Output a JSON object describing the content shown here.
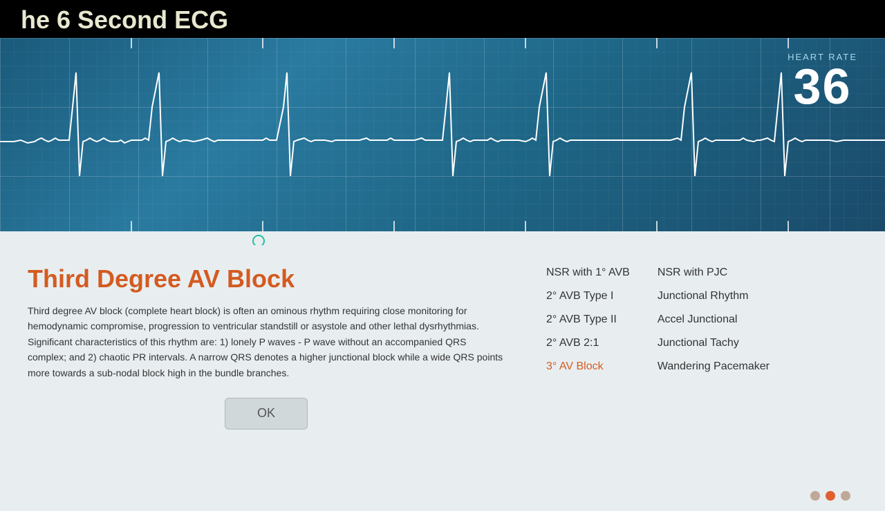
{
  "header": {
    "title": "he 6 Second ECG"
  },
  "ecg": {
    "heart_rate_label": "HEART RATE",
    "heart_rate_value": "36"
  },
  "condition": {
    "title": "Third Degree AV Block",
    "description": "Third degree AV block (complete heart block) is often an ominous rhythm requiring close monitoring for hemodynamic compromise, progression to ventricular standstill or asystole and other lethal dysrhythmias. Significant characteristics of this rhythm are: 1) lonely P waves - P wave without an accompanied QRS complex; and 2) chaotic PR intervals. A narrow QRS denotes a higher junctional block while a wide QRS points more towards a sub-nodal block high in the bundle branches."
  },
  "ok_button": {
    "label": "OK"
  },
  "menu_col1": [
    {
      "label": "NSR with 1° AVB",
      "active": false
    },
    {
      "label": "2° AVB Type I",
      "active": false
    },
    {
      "label": "2° AVB Type II",
      "active": false
    },
    {
      "label": "2° AVB 2:1",
      "active": false
    },
    {
      "label": "3° AV Block",
      "active": true
    }
  ],
  "menu_col2": [
    {
      "label": "NSR with PJC",
      "active": false
    },
    {
      "label": "Junctional Rhythm",
      "active": false
    },
    {
      "label": "Accel Junctional",
      "active": false
    },
    {
      "label": "Junctional Tachy",
      "active": false
    },
    {
      "label": "Wandering Pacemaker",
      "active": false
    }
  ],
  "pagination": {
    "dots": [
      "inactive",
      "active",
      "inactive"
    ]
  },
  "colors": {
    "active_item": "#d45a20",
    "title": "#d45a20",
    "dot_active": "#e06030",
    "dot_inactive": "#c0a898"
  }
}
